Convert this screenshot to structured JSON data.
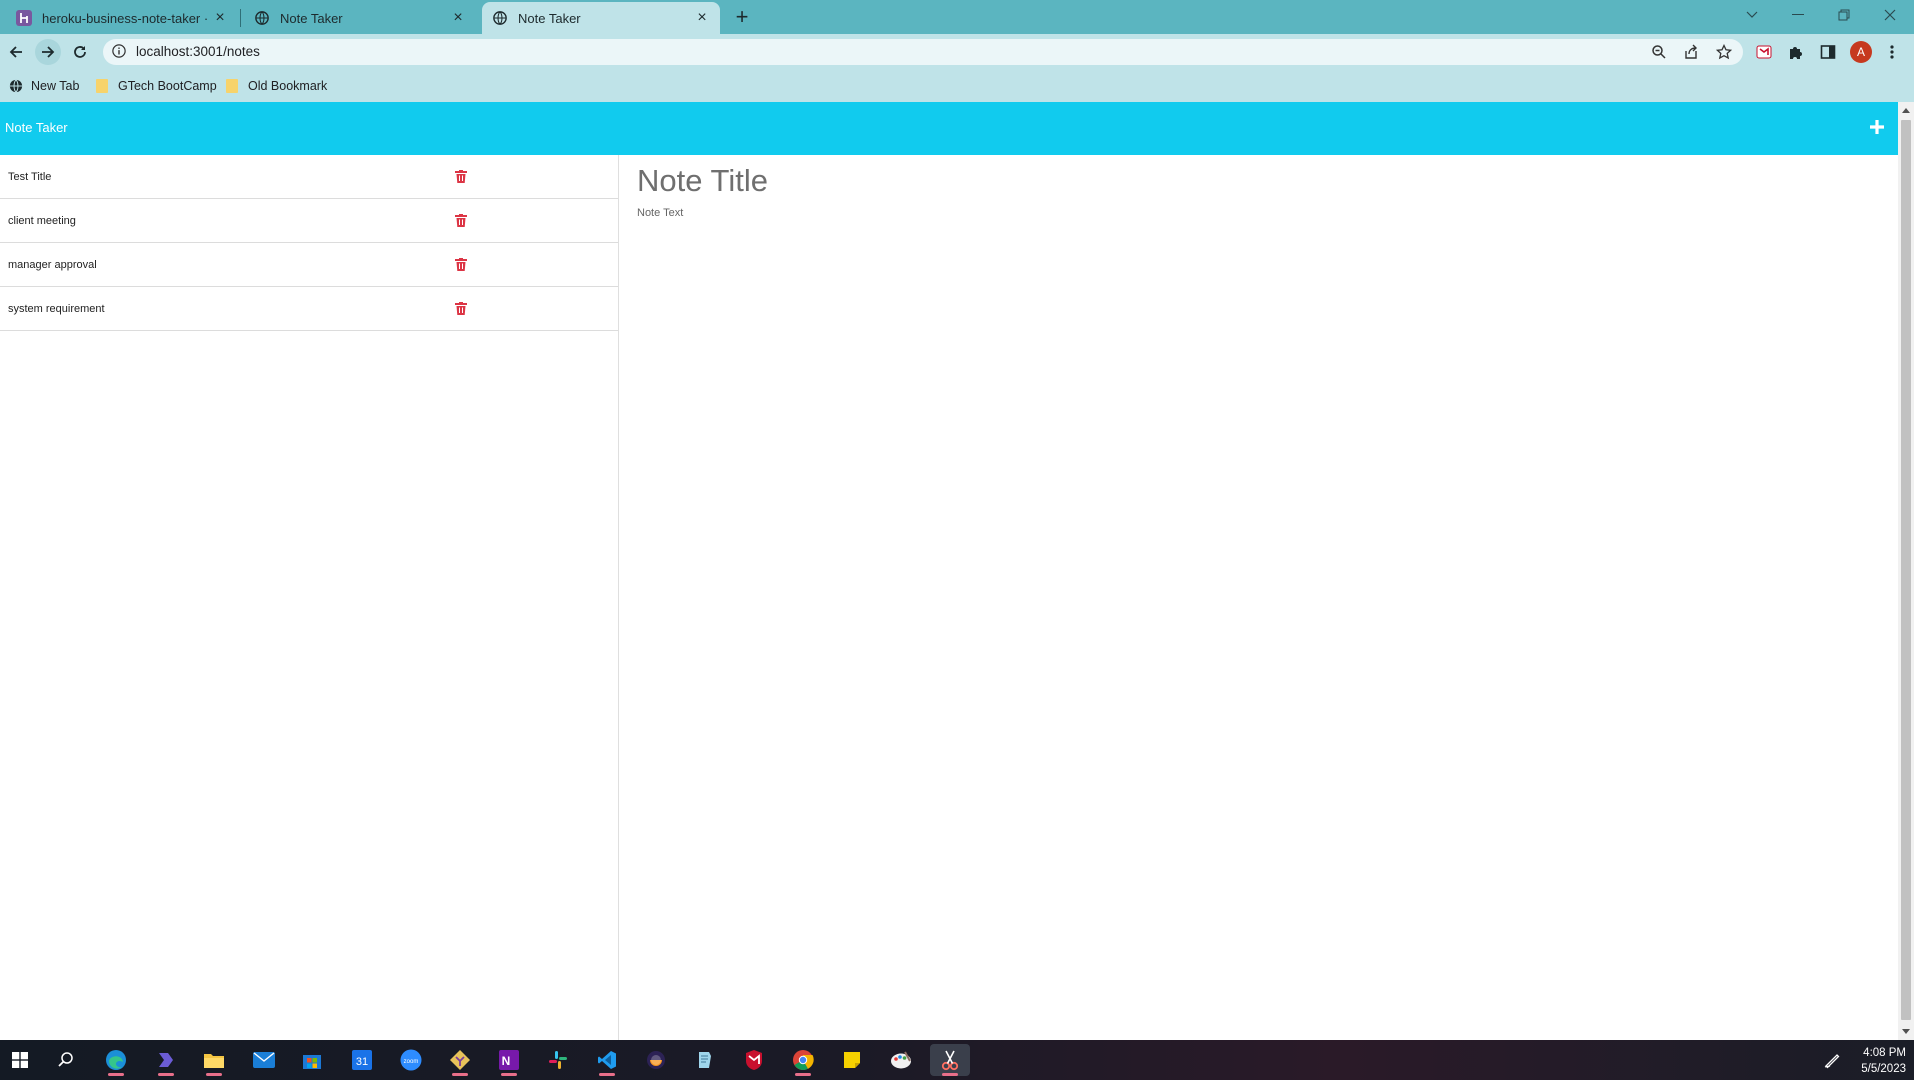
{
  "browser": {
    "tabs": [
      {
        "title": "heroku-business-note-taker · GitH",
        "favicon": "heroku-icon"
      },
      {
        "title": "Note Taker",
        "favicon": "globe-icon"
      },
      {
        "title": "Note Taker",
        "favicon": "globe-icon",
        "active": true
      }
    ],
    "address": "localhost:3001/notes",
    "bookmarks": [
      {
        "label": "New Tab",
        "icon": "globe-icon"
      },
      {
        "label": "GTech BootCamp",
        "icon": "folder-icon"
      },
      {
        "label": "Old Bookmark",
        "icon": "folder-icon"
      }
    ],
    "profile_initial": "A"
  },
  "app": {
    "brand": "Note Taker",
    "accent_color": "#11cbee",
    "notes": [
      {
        "title": "Test Title"
      },
      {
        "title": "client meeting"
      },
      {
        "title": "manager approval"
      },
      {
        "title": "system requirement"
      }
    ],
    "editor": {
      "title_placeholder": "Note Title",
      "text_placeholder": "Note Text"
    }
  },
  "taskbar": {
    "time": "4:08 PM",
    "date": "5/5/2023"
  }
}
